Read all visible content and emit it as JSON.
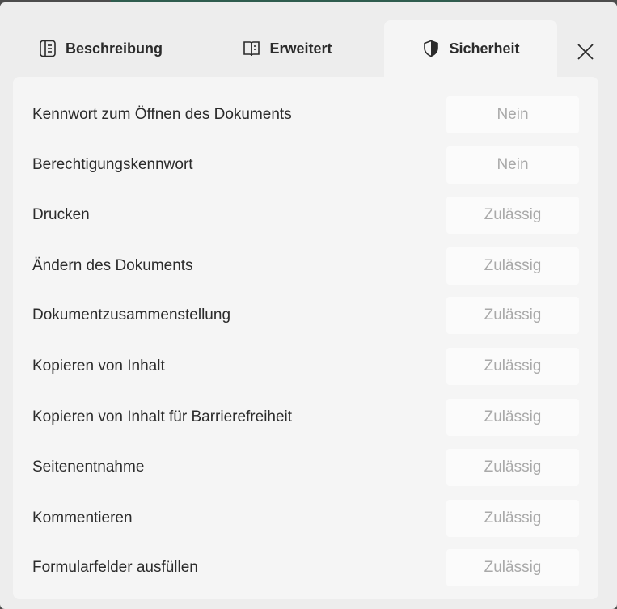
{
  "tabs": [
    {
      "label": "Beschreibung",
      "icon": "document-list-icon"
    },
    {
      "label": "Erweitert",
      "icon": "open-book-icon"
    },
    {
      "label": "Sicherheit",
      "icon": "shield-icon",
      "selected": true
    }
  ],
  "close_icon": "close-icon",
  "security": {
    "rows": [
      {
        "label": "Kennwort zum Öffnen des Dokuments",
        "value": "Nein"
      },
      {
        "label": "Berechtigungskennwort",
        "value": "Nein"
      },
      {
        "label": "Drucken",
        "value": "Zulässig"
      },
      {
        "label": "Ändern des Dokuments",
        "value": "Zulässig"
      },
      {
        "label": "Dokumentzusammenstellung",
        "value": "Zulässig"
      },
      {
        "label": "Kopieren von Inhalt",
        "value": "Zulässig"
      },
      {
        "label": "Kopieren von Inhalt für Barrierefreiheit",
        "value": "Zulässig"
      },
      {
        "label": "Seitenentnahme",
        "value": "Zulässig"
      },
      {
        "label": "Kommentieren",
        "value": "Zulässig"
      },
      {
        "label": "Formularfelder ausfüllen",
        "value": "Zulässig"
      }
    ]
  },
  "colors": {
    "dialog_background": "#ededed",
    "panel_background": "#f5f5f5",
    "value_text": "#a9a9a9",
    "label_text": "#2b2b2b"
  }
}
